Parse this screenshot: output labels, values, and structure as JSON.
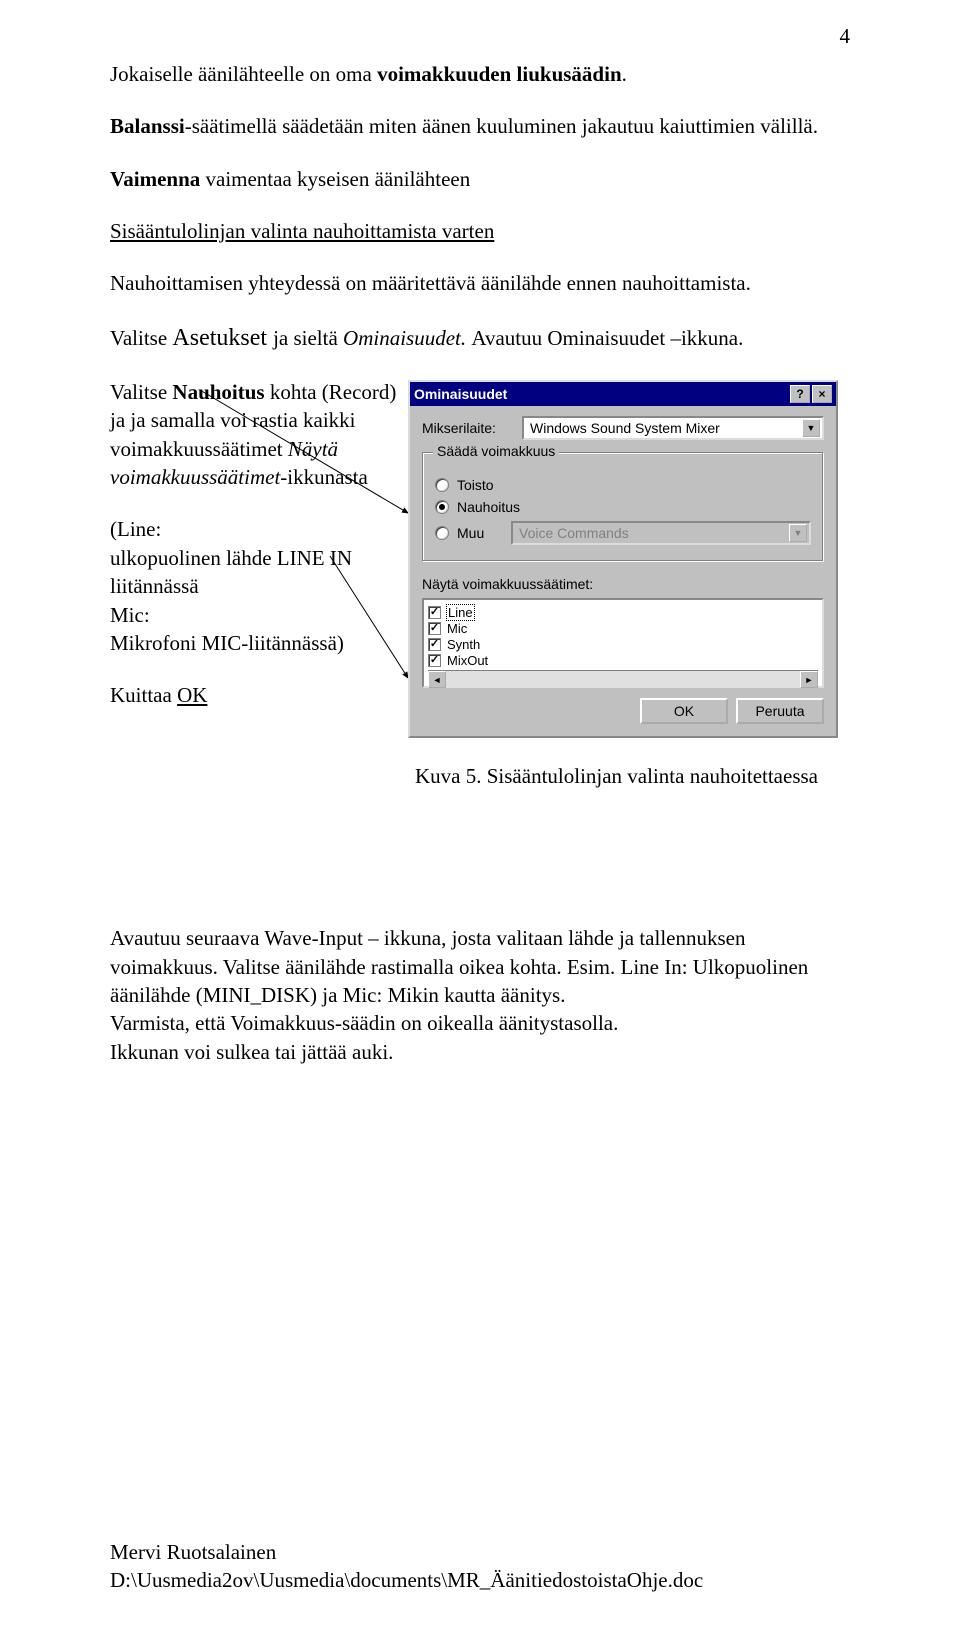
{
  "page_number": "4",
  "para1": {
    "pre": "Jokaiselle äänilähteelle on oma ",
    "bold": "voimakkuuden liukusäädin",
    "post": "."
  },
  "para2": {
    "bold": "Balanssi",
    "post": "-säätimellä säädetään miten äänen kuuluminen jakautuu kaiuttimien välillä."
  },
  "para3": {
    "bold": "Vaimenna ",
    "post": "vaimentaa kyseisen äänilähteen"
  },
  "heading_input_line": "Sisääntulolinjan valinta nauhoittamista varten",
  "para4": "Nauhoittamisen yhteydessä on määritettävä äänilähde ennen nauhoittamista.",
  "para5": {
    "a": "Valitse ",
    "b": "Asetukset ",
    "c": "ja sieltä ",
    "d": " Ominaisuudet. ",
    "e": "Avautuu Ominaisuudet –ikkuna."
  },
  "left": {
    "p1": {
      "a": "Valitse ",
      "b": " Nauhoitus ",
      "c": "kohta (Record) ja ja samalla voi rastia kaikki voimakkuussäätimet ",
      "d": "Näytä voimakkuussäätimet",
      "e": "-ikkunasta"
    },
    "p2": {
      "a": "(Line:",
      "b": " ulkopuolinen lähde LINE IN liitännässä",
      "c": "Mic:",
      "d": "Mikrofoni MIC-liitännässä)"
    },
    "p3": {
      "a": "Kuittaa ",
      "b": "OK"
    }
  },
  "dialog": {
    "title": "Ominaisuudet",
    "help_btn": "?",
    "close_btn": "×",
    "mixer_label": "Mikserilaite:",
    "mixer_value": "Windows Sound System Mixer",
    "group_legend": "Säädä voimakkuus",
    "radio_playback": "Toisto",
    "radio_record": "Nauhoitus",
    "radio_other": "Muu",
    "other_disabled_value": "Voice Commands",
    "list_label": "Näytä voimakkuussäätimet:",
    "list_items": [
      {
        "label": "Line",
        "checked": true,
        "focused": true
      },
      {
        "label": "Mic",
        "checked": true,
        "focused": false
      },
      {
        "label": "Synth",
        "checked": true,
        "focused": false
      },
      {
        "label": "MixOut",
        "checked": true,
        "focused": false
      }
    ],
    "ok_label": "OK",
    "cancel_label": "Peruuta"
  },
  "caption": "Kuva 5. Sisääntulolinjan valinta nauhoitettaessa",
  "para_after": {
    "a": "Avautuu seuraava Wave-Input – ikkuna, josta valitaan lähde ja tallennuksen voimakkuus. Valitse äänilähde rastimalla oikea kohta. Esim. Line In: Ulkopuolinen äänilähde (MINI_DISK) ja Mic: Mikin kautta äänitys.",
    "b": "Varmista, että Voimakkuus-säädin on oikealla äänitystasolla.",
    "c": "Ikkunan voi sulkea tai jättää auki."
  },
  "footer": {
    "name": "Mervi Ruotsalainen",
    "path": "D:\\Uusmedia2ov\\Uusmedia\\documents\\MR_ÄänitiedostoistaOhje.doc"
  }
}
